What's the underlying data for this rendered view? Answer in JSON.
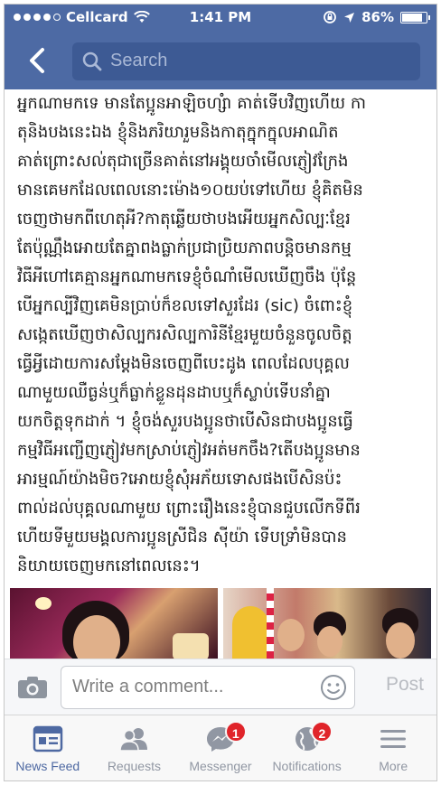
{
  "status_bar": {
    "carrier": "Cellcard",
    "time": "1:41 PM",
    "battery": "86%",
    "battery_level": 0.86
  },
  "nav": {
    "search_placeholder": "Search"
  },
  "post": {
    "lines": [
      "អ្នកណាមកទេ មានតែប្អូនអាឡិចហ្សំា គាត់ទើបវិញហើយ កា",
      "តុនិងបងនេះឯង ខ្ញុំនិងភរិយារួមនិងកាតុក្នុកក្នុលអាណិត",
      "គាត់ព្រោះសល់តុជាច្រើនគាត់នៅអង្គុយចាំមើលភ្ញៀវក្រែង",
      "មានគេមកដែលពេលនោះម៉ោង១០យប់ទៅហើយ ខ្ញុំគិតមិន",
      "ចេញថាមកពីហេតុអី?កាតុឆ្លើយថាបងអើយអ្នកសិល្បៈខ្មែរ",
      "តែប៉ុណ្ណឹងអោយតែគ្នាពងធ្លាក់ប្រជាប្រិយភាពបន្តិចមានកម្ម",
      "វិធីអីហៅគេគ្មានអ្នកណាមកទេខ្ញុំចំណាំមើលឃើញចឹង ប៉ុន្តែ",
      "បើអ្នកល្បីវិញគេមិនប្រាប់ក៏ខលទៅសួរដែរ (sic) ចំពោះខ្ញុំ",
      "សង្កេតឃើញថាសិល្បករសិល្បការិនីខ្មែរមួយចំនួនចូលចិត្ត",
      "ធ្វើអ្វីដោយការសម្ដែងមិនចេញពីបេះដូង ពេលដែលបុគ្គល",
      "ណាមួយឈឺធ្ងន់ឬក៏ធ្លាក់ខ្លួនដុនដាបឬក៏ស្លាប់ទើបនាំគ្នា",
      "យកចិត្តទុកដាក់ ។ ខ្ញុំចង់សួរបងប្អូនថាបើសិនជាបងប្អូនធ្វើ",
      "កម្មវិធីអញ្ជើញភ្ញៀវមកស្រាប់ភ្ញៀវអត់មកចឹង?តើបងប្អូនមាន",
      "អារម្មណ៍យ៉ាងមិច?អោយខ្ញុំសុំអភ័យទោសផងបើសិនប៉ះ",
      "ពាល់ដល់បុគ្គលណាមួយ ព្រោះរឿងនេះខ្ញុំបានជួបលើកទីពីរ",
      "ហើយទីមួយមង្គលការប្អូនស្រីជិន ស៊ីយ៉ា ទើបទ្រាំមិនបាន",
      "និយាយចេញមកនៅពេលនេះ។"
    ]
  },
  "comment_bar": {
    "placeholder": "Write a comment...",
    "post_label": "Post"
  },
  "tabs": [
    {
      "label": "News Feed",
      "icon": "news-feed-icon",
      "active": true
    },
    {
      "label": "Requests",
      "icon": "friend-requests-icon"
    },
    {
      "label": "Messenger",
      "icon": "messenger-icon",
      "badge": "1"
    },
    {
      "label": "Notifications",
      "icon": "globe-icon",
      "badge": "2"
    },
    {
      "label": "More",
      "icon": "menu-icon"
    }
  ],
  "colors": {
    "brand": "#4d6aa4",
    "badge": "#e0242a",
    "active_tab": "#4e69a2",
    "inactive_tab": "#9197a3"
  }
}
